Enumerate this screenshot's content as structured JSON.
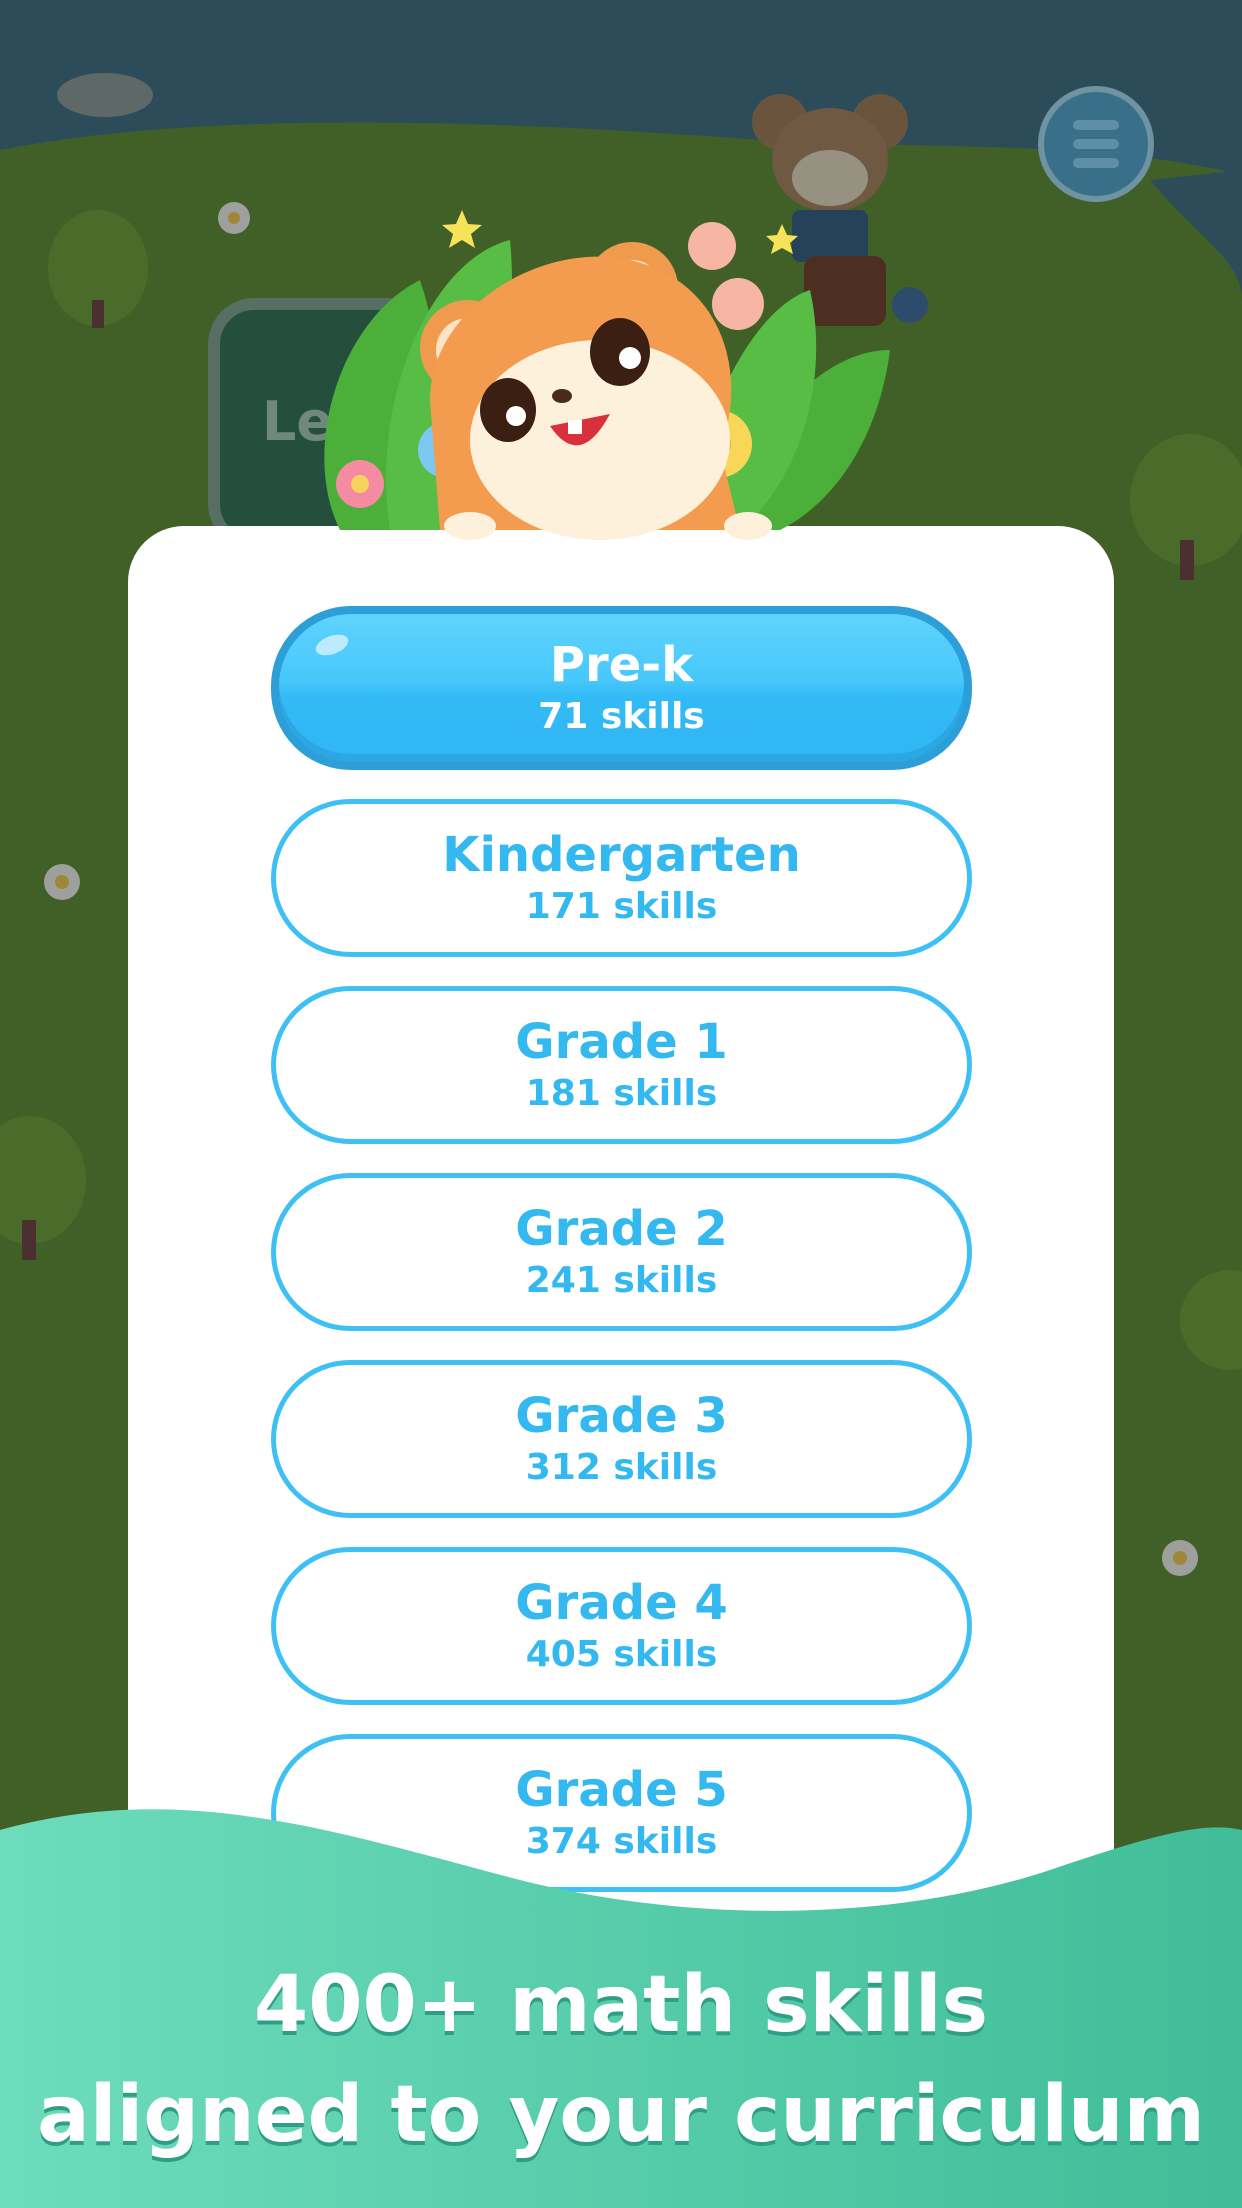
{
  "header": {
    "menu_icon": "hamburger-menu-icon",
    "background_sign_fragment": "Le"
  },
  "mascot": {
    "icon": "hamster-mascot-icon"
  },
  "grades": [
    {
      "name": "Pre-k",
      "count": "71 skills",
      "selected": true
    },
    {
      "name": "Kindergarten",
      "count": "171 skills",
      "selected": false
    },
    {
      "name": "Grade 1",
      "count": "181 skills",
      "selected": false
    },
    {
      "name": "Grade 2",
      "count": "241 skills",
      "selected": false
    },
    {
      "name": "Grade 3",
      "count": "312 skills",
      "selected": false
    },
    {
      "name": "Grade 4",
      "count": "405 skills",
      "selected": false
    },
    {
      "name": "Grade 5",
      "count": "374 skills",
      "selected": false
    }
  ],
  "footer": {
    "line1": "400+ math skills",
    "line2": "aligned to your curriculum"
  },
  "colors": {
    "accent": "#33b8f0",
    "footer_gradient_start": "#6ddcbc",
    "footer_gradient_end": "#40bd98",
    "background_grass": "#4b6a2e"
  }
}
